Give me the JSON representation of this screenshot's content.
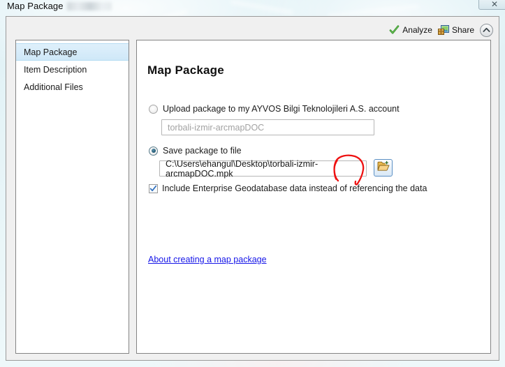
{
  "window": {
    "title": "Map Package",
    "close_label": "✕",
    "close_icon": "close-icon"
  },
  "toolbar": {
    "analyze_label": "Analyze",
    "analyze_icon": "green-check-icon",
    "share_label": "Share",
    "share_icon": "package-share-icon",
    "collapse_icon": "chevron-up-icon"
  },
  "sidebar": {
    "items": [
      {
        "label": "Map Package",
        "selected": true
      },
      {
        "label": "Item Description",
        "selected": false
      },
      {
        "label": "Additional Files",
        "selected": false
      }
    ]
  },
  "main": {
    "heading": "Map Package",
    "upload_option": {
      "label": "Upload package to my AYVOS Bilgi Teknolojileri A.S. account",
      "selected": false,
      "field_value": "torbali-izmir-arcmapDOC",
      "field_enabled": false
    },
    "save_option": {
      "label": "Save package to file",
      "selected": true,
      "field_value": "C:\\Users\\ehangul\\Desktop\\torbali-izmir-arcmapDOC.mpk",
      "browse_icon": "open-folder-icon"
    },
    "include_geodatabase": {
      "label": "Include Enterprise Geodatabase data instead of referencing the data",
      "checked": true
    },
    "help_link": "About creating a map package"
  },
  "annotation": {
    "shape": "hand-drawn-red-circle",
    "color": "#ee1111",
    "targets": ".mpk"
  },
  "colors": {
    "accent_link": "#1515e8",
    "selection": "#cfe8f8",
    "annotation_red": "#ee1111",
    "check_green": "#2e8b22",
    "panel_bg": "#f0f0f0",
    "desktop": "#e4f3f7"
  }
}
